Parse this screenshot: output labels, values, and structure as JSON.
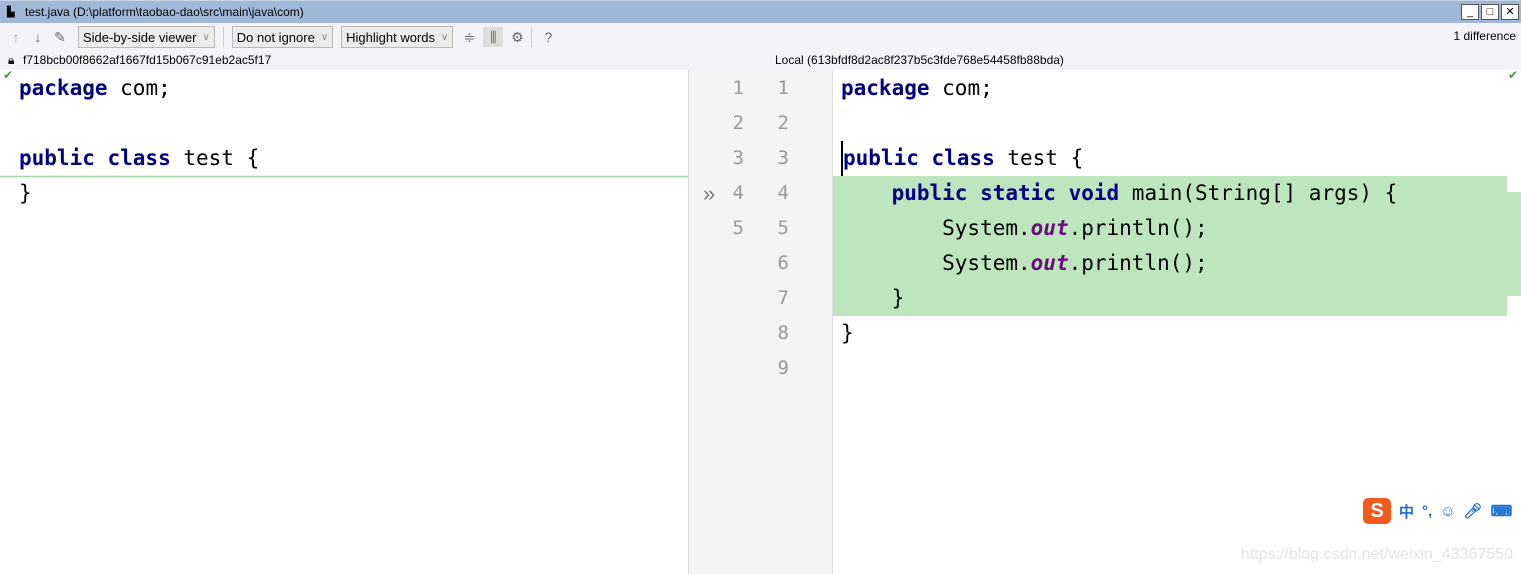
{
  "window": {
    "title": "test.java (D:\\platform\\taobao-dao\\src\\main\\java\\com)",
    "min": "_",
    "max": "□",
    "close": "✕"
  },
  "toolbar": {
    "viewer": "Side-by-side viewer",
    "ignore": "Do not ignore",
    "highlight": "Highlight words",
    "help": "?",
    "difference_count": "1 difference"
  },
  "left": {
    "revision": "f718bcb00f8662af1667fd15b067c91eb2ac5f17",
    "line_numbers": [
      "1",
      "2",
      "3",
      "4",
      "5"
    ]
  },
  "right": {
    "revision": "Local (613bfdf8d2ac8f237b5c3fde768e54458fb88bda)",
    "line_numbers": [
      "1",
      "2",
      "3",
      "4",
      "5",
      "6",
      "7",
      "8",
      "9"
    ]
  },
  "colors": {
    "added": "#bee6be",
    "keyword": "#000080",
    "static_field": "#660e7a"
  },
  "ime": {
    "lang": "中",
    "punct": "°,"
  },
  "watermark": "https://blog.csdn.net/weixin_43367550"
}
